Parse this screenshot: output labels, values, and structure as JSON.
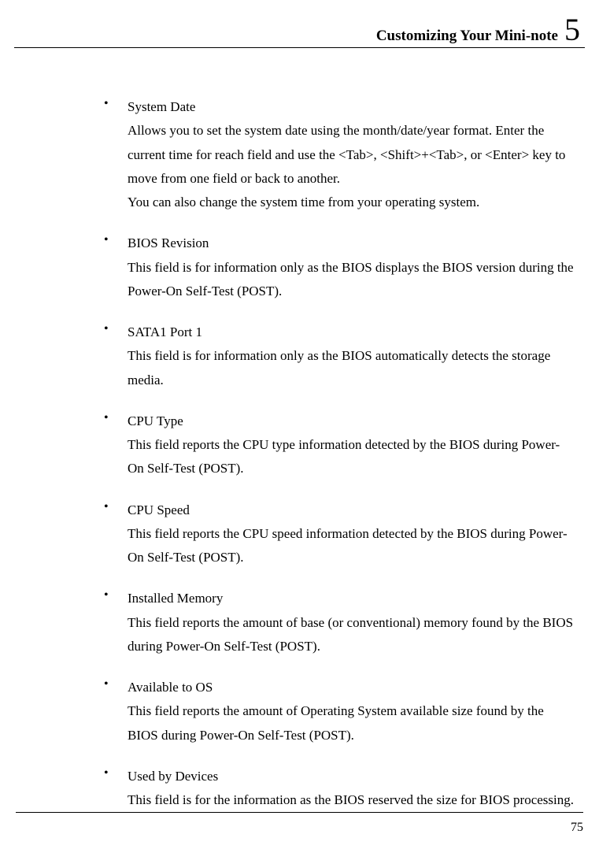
{
  "header": {
    "title": "Customizing Your Mini-note",
    "chapter_number": "5"
  },
  "items": [
    {
      "title": "System Date",
      "desc": "Allows you to set the system date using the month/date/year format. Enter the current time for reach field and use the <Tab>, <Shift>+<Tab>, or <Enter>  key to move from one field or back to another.",
      "extra": "You can also change the system time from your operating system."
    },
    {
      "title": "BIOS Revision",
      "desc": "This field is for information only as the BIOS displays the BIOS version during the Power-On Self-Test (POST)."
    },
    {
      "title": "SATA1 Port 1",
      "desc": "This field is for information only as the BIOS automatically detects the storage media."
    },
    {
      "title": "CPU Type",
      "desc": "This field reports the CPU type information detected by the BIOS during Power-On Self-Test (POST)."
    },
    {
      "title": "CPU Speed",
      "desc": "This field reports the CPU speed information detected by the BIOS during Power-On Self-Test (POST)."
    },
    {
      "title": "Installed Memory",
      "desc": "This field reports the amount of base (or conventional) memory found by the BIOS during Power-On Self-Test (POST)."
    },
    {
      "title": "Available to OS",
      "desc": "This field reports the amount of Operating System available size found by the BIOS during Power-On Self-Test (POST)."
    },
    {
      "title": "Used by Devices",
      "desc": "This field is for the information as the BIOS reserved the size for BIOS processing."
    }
  ],
  "page_number": "75"
}
